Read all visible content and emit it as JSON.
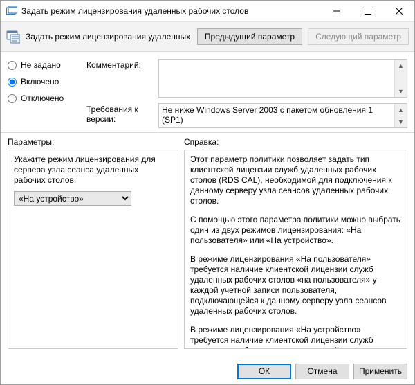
{
  "window": {
    "title": "Задать режим лицензирования удаленных рабочих столов"
  },
  "header": {
    "title": "Задать режим лицензирования удаленных рабочих столов",
    "prev": "Предыдущий параметр",
    "next": "Следующий параметр"
  },
  "state": {
    "options": {
      "not_configured": "Не задано",
      "enabled": "Включено",
      "disabled": "Отключено"
    },
    "selected": "enabled"
  },
  "fields": {
    "comment_label": "Комментарий:",
    "comment_value": "",
    "supported_label": "Требования к версии:",
    "supported_value": "Не ниже Windows Server 2003 с пакетом обновления 1 (SP1)"
  },
  "panes": {
    "options_label": "Параметры:",
    "help_label": "Справка:"
  },
  "options": {
    "mode_label": "Укажите режим лицензирования для сервера узла сеанса удаленных рабочих столов.",
    "mode_values": [
      "«На устройство»",
      "«На пользователя»"
    ],
    "mode_selected": "«На устройство»"
  },
  "help": {
    "p1": "Этот параметр политики позволяет задать тип клиентской лицензии служб удаленных рабочих столов (RDS CAL), необходимой для подключения к данному серверу узла сеансов удаленных рабочих столов.",
    "p2": "С помощью этого параметра политики можно выбрать один из двух режимов лицензирования: «На пользователя» или «На устройство».",
    "p3": "В режиме лицензирования «На пользователя» требуется наличие клиентской лицензии служб удаленных рабочих столов «на пользователя» у каждой учетной записи пользователя, подключающейся к данному серверу узла сеансов удаленных рабочих столов.",
    "p4": "В режиме лицензирования «На устройство» требуется наличие клиентской лицензии служб удаленных рабочих столов «на устройство» у каждого устройства, подключающегося к данному серверу узла сеансов удаленных рабочих столов."
  },
  "buttons": {
    "ok": "ОК",
    "cancel": "Отмена",
    "apply": "Применить"
  }
}
